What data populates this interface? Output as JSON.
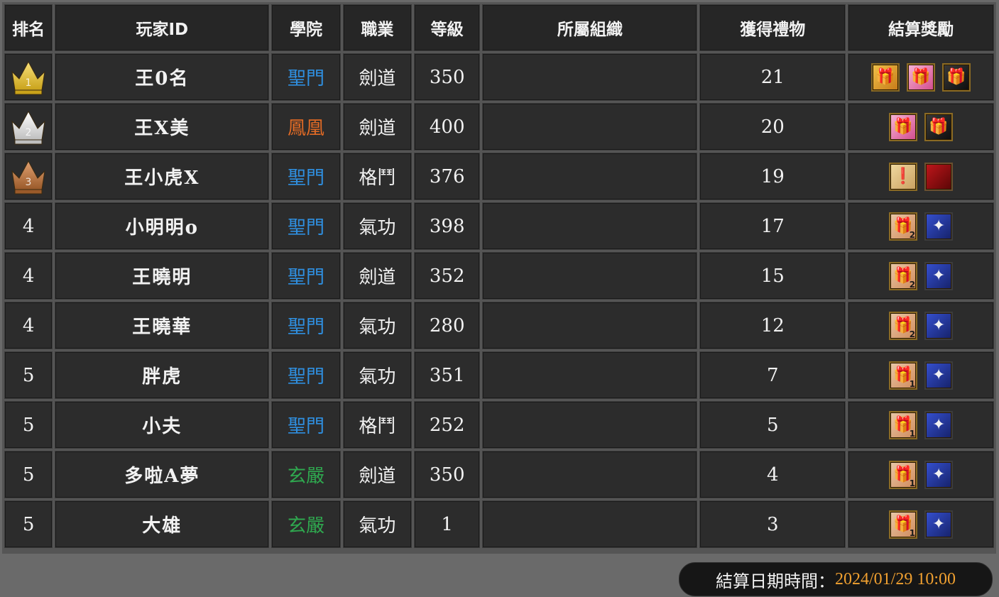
{
  "columns": [
    "排名",
    "玩家ID",
    "學院",
    "職業",
    "等級",
    "所屬組織",
    "獲得禮物",
    "結算獎勵"
  ],
  "colors": {
    "聖門": "#2f8fe0",
    "鳳凰": "#e06a25",
    "玄嚴": "#2fa84f"
  },
  "rows": [
    {
      "rank": "1",
      "rank_icon": "gold-crown-icon",
      "player": "王0名",
      "school": "聖門",
      "job": "劍道",
      "level": "350",
      "org": "",
      "gifts": "21",
      "rewards": [
        {
          "icon": "gold-gift",
          "glyph": "🎁",
          "qty": ""
        },
        {
          "icon": "pink-gift",
          "glyph": "🎁",
          "qty": ""
        },
        {
          "icon": "black-gift",
          "glyph": "🎁",
          "qty": ""
        }
      ]
    },
    {
      "rank": "2",
      "rank_icon": "silver-crown-icon",
      "player": "王X美",
      "school": "鳳凰",
      "job": "劍道",
      "level": "400",
      "org": "",
      "gifts": "20",
      "rewards": [
        {
          "icon": "pink-gift",
          "glyph": "🎁",
          "qty": ""
        },
        {
          "icon": "black-gift",
          "glyph": "🎁",
          "qty": ""
        }
      ]
    },
    {
      "rank": "3",
      "rank_icon": "bronze-crown-icon",
      "player": "王小虎X",
      "school": "聖門",
      "job": "格鬥",
      "level": "376",
      "org": "",
      "gifts": "19",
      "rewards": [
        {
          "icon": "note",
          "glyph": "❗",
          "qty": ""
        },
        {
          "icon": "red-card",
          "glyph": "",
          "qty": ""
        }
      ]
    },
    {
      "rank": "4",
      "rank_icon": "",
      "player": "小明明o",
      "school": "聖門",
      "job": "氣功",
      "level": "398",
      "org": "",
      "gifts": "17",
      "rewards": [
        {
          "icon": "pink-box",
          "glyph": "🎁",
          "qty": "2"
        },
        {
          "icon": "star",
          "glyph": "✦",
          "qty": ""
        }
      ]
    },
    {
      "rank": "4",
      "rank_icon": "",
      "player": "王曉明",
      "school": "聖門",
      "job": "劍道",
      "level": "352",
      "org": "",
      "gifts": "15",
      "rewards": [
        {
          "icon": "pink-box",
          "glyph": "🎁",
          "qty": "2"
        },
        {
          "icon": "star",
          "glyph": "✦",
          "qty": ""
        }
      ]
    },
    {
      "rank": "4",
      "rank_icon": "",
      "player": "王曉華",
      "school": "聖門",
      "job": "氣功",
      "level": "280",
      "org": "",
      "gifts": "12",
      "rewards": [
        {
          "icon": "pink-box",
          "glyph": "🎁",
          "qty": "2"
        },
        {
          "icon": "star",
          "glyph": "✦",
          "qty": ""
        }
      ]
    },
    {
      "rank": "5",
      "rank_icon": "",
      "player": "胖虎",
      "school": "聖門",
      "job": "氣功",
      "level": "351",
      "org": "",
      "gifts": "7",
      "rewards": [
        {
          "icon": "pink-box",
          "glyph": "🎁",
          "qty": "1"
        },
        {
          "icon": "star",
          "glyph": "✦",
          "qty": ""
        }
      ]
    },
    {
      "rank": "5",
      "rank_icon": "",
      "player": "小夫",
      "school": "聖門",
      "job": "格鬥",
      "level": "252",
      "org": "",
      "gifts": "5",
      "rewards": [
        {
          "icon": "pink-box",
          "glyph": "🎁",
          "qty": "1"
        },
        {
          "icon": "star",
          "glyph": "✦",
          "qty": ""
        }
      ]
    },
    {
      "rank": "5",
      "rank_icon": "",
      "player": "多啦A夢",
      "school": "玄嚴",
      "job": "劍道",
      "level": "350",
      "org": "",
      "gifts": "4",
      "rewards": [
        {
          "icon": "pink-box",
          "glyph": "🎁",
          "qty": "1"
        },
        {
          "icon": "star",
          "glyph": "✦",
          "qty": ""
        }
      ]
    },
    {
      "rank": "5",
      "rank_icon": "",
      "player": "大雄",
      "school": "玄嚴",
      "job": "氣功",
      "level": "1",
      "org": "",
      "gifts": "3",
      "rewards": [
        {
          "icon": "pink-box",
          "glyph": "🎁",
          "qty": "1"
        },
        {
          "icon": "star",
          "glyph": "✦",
          "qty": ""
        }
      ]
    }
  ],
  "footer": {
    "label": "結算日期時間：",
    "value": "2024/01/29 10:00"
  }
}
